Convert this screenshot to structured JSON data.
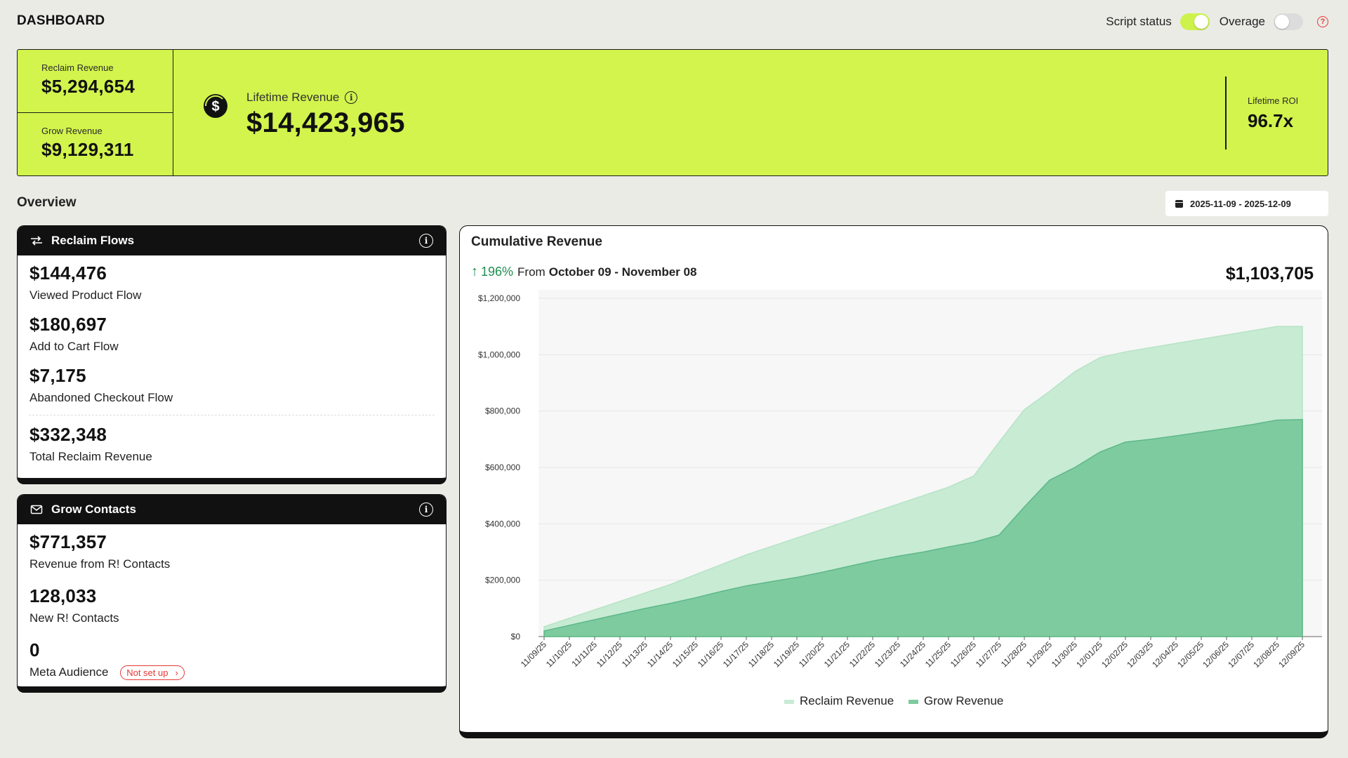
{
  "header": {
    "title": "DASHBOARD",
    "script_status_label": "Script status",
    "script_status_on": true,
    "overage_label": "Overage",
    "overage_on": false,
    "help_icon": "help-icon"
  },
  "banner": {
    "reclaim_label": "Reclaim Revenue",
    "reclaim_value": "$5,294,654",
    "grow_label": "Grow Revenue",
    "grow_value": "$9,129,311",
    "lifetime_label": "Lifetime Revenue",
    "lifetime_value": "$14,423,965",
    "roi_label": "Lifetime ROI",
    "roi_value": "96.7x",
    "accent": "#d2f44c"
  },
  "overview": {
    "title": "Overview",
    "date_range": "2025-11-09 - 2025-12-09"
  },
  "reclaim_card": {
    "title": "Reclaim Flows",
    "metrics": [
      {
        "value": "$144,476",
        "label": "Viewed Product Flow"
      },
      {
        "value": "$180,697",
        "label": "Add to Cart Flow"
      },
      {
        "value": "$7,175",
        "label": "Abandoned Checkout Flow"
      }
    ],
    "total": {
      "value": "$332,348",
      "label": "Total Reclaim Revenue"
    }
  },
  "grow_card": {
    "title": "Grow Contacts",
    "metrics": [
      {
        "value": "$771,357",
        "label": "Revenue from R! Contacts"
      },
      {
        "value": "128,033",
        "label": "New R! Contacts"
      },
      {
        "value": "0",
        "label": "Meta Audience"
      }
    ],
    "badge": "Not set up"
  },
  "chart": {
    "title": "Cumulative Revenue",
    "delta_pct": "196%",
    "delta_from": "From",
    "delta_range": "October 09 - November 08",
    "total": "$1,103,705"
  },
  "chart_data": {
    "type": "area",
    "title": "Cumulative Revenue",
    "x": [
      "11/09/25",
      "11/10/25",
      "11/11/25",
      "11/12/25",
      "11/13/25",
      "11/14/25",
      "11/15/25",
      "11/16/25",
      "11/17/25",
      "11/18/25",
      "11/19/25",
      "11/20/25",
      "11/21/25",
      "11/22/25",
      "11/23/25",
      "11/24/25",
      "11/25/25",
      "11/26/25",
      "11/27/25",
      "11/28/25",
      "11/29/25",
      "11/30/25",
      "12/01/25",
      "12/02/25",
      "12/03/25",
      "12/04/25",
      "12/05/25",
      "12/06/25",
      "12/07/25",
      "12/08/25",
      "12/09/25"
    ],
    "series": [
      {
        "name": "Reclaim Revenue",
        "color": "#c8ebd4",
        "values": [
          35000,
          65000,
          95000,
          125000,
          155000,
          185000,
          220000,
          255000,
          290000,
          320000,
          350000,
          380000,
          410000,
          440000,
          470000,
          500000,
          530000,
          570000,
          690000,
          805000,
          870000,
          940000,
          990000,
          1010000,
          1025000,
          1040000,
          1055000,
          1070000,
          1085000,
          1100000,
          1100000
        ]
      },
      {
        "name": "Grow Revenue",
        "color": "#7ecba0",
        "values": [
          20000,
          40000,
          60000,
          80000,
          100000,
          118000,
          138000,
          160000,
          180000,
          195000,
          210000,
          228000,
          248000,
          268000,
          285000,
          300000,
          318000,
          335000,
          360000,
          460000,
          555000,
          600000,
          655000,
          690000,
          700000,
          712000,
          725000,
          738000,
          752000,
          768000,
          770000
        ]
      }
    ],
    "ylim": [
      0,
      1200000
    ],
    "yticks": [
      "$0",
      "$200,000",
      "$400,000",
      "$600,000",
      "$800,000",
      "$1,000,000",
      "$1,200,000"
    ],
    "ytick_values": [
      0,
      200000,
      400000,
      600000,
      800000,
      1000000,
      1200000
    ],
    "grid": true,
    "legend": "bottom"
  }
}
